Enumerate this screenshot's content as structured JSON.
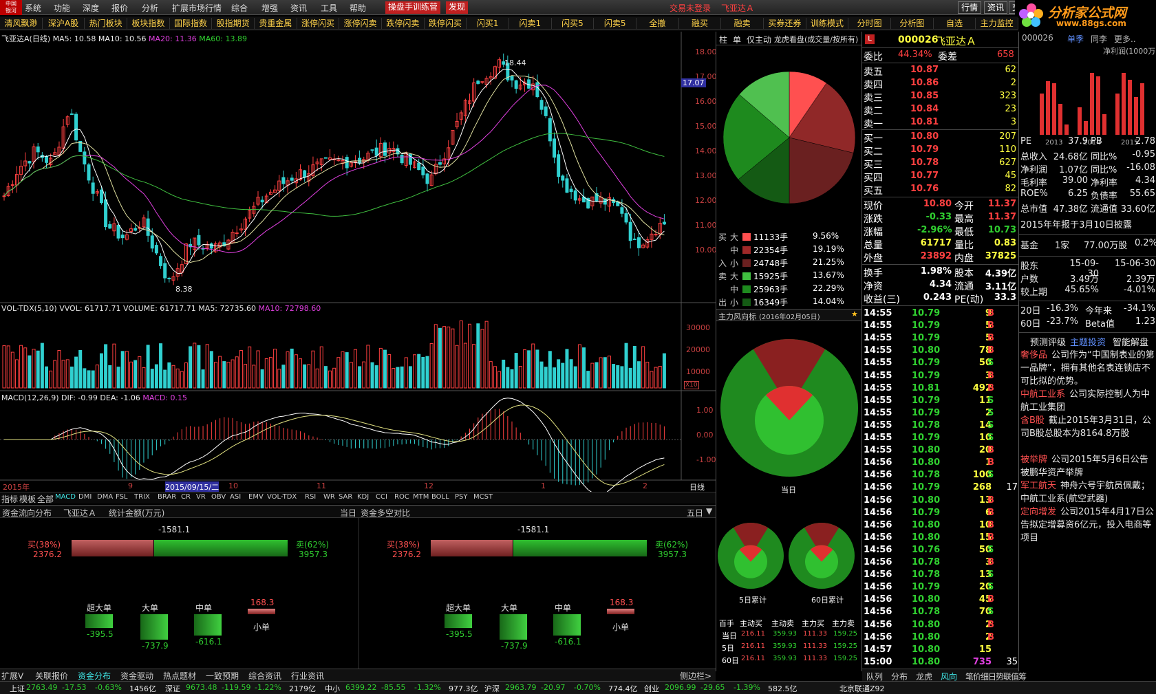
{
  "menu": {
    "items": [
      "系统",
      "功能",
      "深度",
      "报价",
      "分析",
      "扩展市场行情",
      "综合",
      "增强",
      "资讯",
      "工具",
      "帮助"
    ],
    "training": "操盘手训练营",
    "discover": "发现",
    "trade_status": "交易未登录",
    "stock_name_title": "飞亚达Ａ",
    "right_buttons": [
      "行情",
      "资讯",
      "交"
    ]
  },
  "logo": {
    "text": "中国\n银河"
  },
  "watermark": {
    "title": "分析家公式网",
    "url": "www.88gs.com"
  },
  "quickbar": [
    "清风飘渺",
    "深沪A股",
    "热门板块",
    "板块指数",
    "国际指数",
    "股指期货",
    "贵重金属",
    "涨停闪买",
    "涨停闪卖",
    "跌停闪卖",
    "跌停闪买",
    "闪买1",
    "闪卖1",
    "闪买5",
    "闪卖5",
    "全撤",
    "融买",
    "融卖",
    "买券还券",
    "训练模式",
    "分时图",
    "分析图",
    "自选",
    "主力监控"
  ],
  "chart": {
    "title": "飞亚达A(日线)",
    "ma5": "MA5: 10.58",
    "ma10": "MA10: 10.56",
    "ma20": "MA20: 11.36",
    "ma60": "MA60: 13.89",
    "price_axis": [
      "18.00",
      "17.00",
      "16.00",
      "15.00",
      "14.00",
      "13.00",
      "12.00",
      "11.00",
      "10.00"
    ],
    "current_price_tag": "17.07",
    "high_label": "18.44",
    "low_label": "8.38",
    "vol_title": "VOL-TDX(5,10)",
    "vvol": "VVOL: 61717.71",
    "volume": "VOLUME: 61717.71",
    "vma5": "MA5: 72735.60",
    "vma10": "MA10: 72798.60",
    "vol_axis": [
      "30000",
      "20000",
      "10000"
    ],
    "vol_unit": "X10",
    "macd_title": "MACD(12,26,9)",
    "dif": "DIF: -0.99",
    "dea": "DEA: -1.06",
    "macd": "MACD: 0.15",
    "macd_axis": [
      "1.00",
      "0.00",
      "-1.00"
    ],
    "time_axis": [
      "2015年",
      "9",
      "2015/09/15/二",
      "10",
      "11",
      "12",
      "1",
      "2"
    ],
    "period": "日线",
    "indicator_tabs": [
      "指标",
      "模板",
      "全部",
      "MACD",
      "DMI",
      "DMA",
      "FSL",
      "TRIX",
      "BRAR",
      "CR",
      "VR",
      "OBV",
      "ASI",
      "EMV",
      "VOL-TDX",
      "RSI",
      "WR",
      "SAR",
      "KDJ",
      "CCI",
      "ROC",
      "MTM",
      "BOLL",
      "PSY",
      "MCST"
    ]
  },
  "bigorder": {
    "tabs": [
      "柱",
      "单",
      "仅主动",
      "龙虎看盘(成交量/按所有)"
    ],
    "rows": [
      {
        "side": "买",
        "size": "大",
        "vol": "11133手",
        "pct": "9.56%",
        "color": "#ff5050"
      },
      {
        "side": "",
        "size": "中",
        "vol": "22354手",
        "pct": "19.19%",
        "color": "#a02828"
      },
      {
        "side": "入",
        "size": "小",
        "vol": "24748手",
        "pct": "21.25%",
        "color": "#6a2020"
      },
      {
        "side": "卖",
        "size": "大",
        "vol": "15925手",
        "pct": "13.67%",
        "color": "#40c040"
      },
      {
        "side": "",
        "size": "中",
        "vol": "25963手",
        "pct": "22.29%",
        "color": "#1e8a1e"
      },
      {
        "side": "出",
        "size": "小",
        "vol": "16349手",
        "pct": "14.04%",
        "color": "#145a14"
      }
    ],
    "pie_values": [
      9.56,
      19.19,
      21.25,
      14.04,
      22.29,
      13.67
    ],
    "wind_title": "主力风向标",
    "wind_date": "(2016年02月05日)",
    "today": "当日",
    "five": "5日累计",
    "sixty": "60日累计",
    "table_header": [
      "百手",
      "主动买",
      "主动卖",
      "主力买",
      "主力卖"
    ],
    "table_rows": [
      [
        "当日",
        "216.11",
        "359.93",
        "111.33",
        "159.25"
      ],
      [
        "5日",
        "216.11",
        "359.93",
        "111.33",
        "159.25"
      ],
      [
        "60日",
        "216.11",
        "359.93",
        "111.33",
        "159.25"
      ]
    ]
  },
  "quote": {
    "code": "000026",
    "name": "飞亚达Ａ",
    "weibi_label": "委比",
    "weibi": "44.34%",
    "weicha_label": "委差",
    "weicha": "658",
    "sells": [
      [
        "卖五",
        "10.87",
        "62"
      ],
      [
        "卖四",
        "10.86",
        "2"
      ],
      [
        "卖三",
        "10.85",
        "323"
      ],
      [
        "卖二",
        "10.84",
        "23"
      ],
      [
        "卖一",
        "10.81",
        "3"
      ]
    ],
    "buys": [
      [
        "买一",
        "10.80",
        "207"
      ],
      [
        "买二",
        "10.79",
        "110"
      ],
      [
        "买三",
        "10.78",
        "627"
      ],
      [
        "买四",
        "10.77",
        "45"
      ],
      [
        "买五",
        "10.76",
        "82"
      ]
    ],
    "info": [
      [
        "现价",
        "10.80",
        "今开",
        "11.37"
      ],
      [
        "涨跌",
        "-0.33",
        "最高",
        "11.37"
      ],
      [
        "涨幅",
        "-2.96%",
        "最低",
        "10.73"
      ],
      [
        "总量",
        "61717",
        "量比",
        "0.83"
      ],
      [
        "外盘",
        "23892",
        "内盘",
        "37825"
      ]
    ],
    "info2": [
      [
        "换手",
        "1.98%",
        "股本",
        "4.39亿"
      ],
      [
        "净资",
        "4.34",
        "流通",
        "3.11亿"
      ],
      [
        "收益(三)",
        "0.243",
        "PE(动)",
        "33.3"
      ]
    ],
    "ticks": [
      [
        "14:55",
        "10.79",
        "9",
        "B"
      ],
      [
        "14:55",
        "10.79",
        "5",
        "B"
      ],
      [
        "14:55",
        "10.79",
        "5",
        "B"
      ],
      [
        "14:55",
        "10.80",
        "78",
        "B"
      ],
      [
        "14:55",
        "10.79",
        "50",
        "S"
      ],
      [
        "14:55",
        "10.79",
        "3",
        "B"
      ],
      [
        "14:55",
        "10.81",
        "492",
        "B"
      ],
      [
        "14:55",
        "10.79",
        "11",
        "S"
      ],
      [
        "14:55",
        "10.79",
        "2",
        "S"
      ],
      [
        "14:55",
        "10.78",
        "14",
        "S"
      ],
      [
        "14:55",
        "10.79",
        "10",
        "S"
      ],
      [
        "14:55",
        "10.80",
        "20",
        "B"
      ],
      [
        "14:56",
        "10.80",
        "1",
        "B"
      ],
      [
        "14:56",
        "10.78",
        "100",
        "S"
      ],
      [
        "14:56",
        "10.79",
        "268",
        ""
      ],
      [
        "14:56",
        "10.80",
        "13",
        "B"
      ],
      [
        "14:56",
        "10.79",
        "6",
        "B"
      ],
      [
        "14:56",
        "10.80",
        "10",
        "B"
      ],
      [
        "14:56",
        "10.80",
        "15",
        "B"
      ],
      [
        "14:56",
        "10.76",
        "50",
        "S"
      ],
      [
        "14:56",
        "10.78",
        "3",
        "B"
      ],
      [
        "14:56",
        "10.78",
        "13",
        "S"
      ],
      [
        "14:56",
        "10.79",
        "20",
        "S"
      ],
      [
        "14:56",
        "10.80",
        "45",
        "B"
      ],
      [
        "14:56",
        "10.78",
        "70",
        "S"
      ],
      [
        "14:56",
        "10.80",
        "2",
        "B"
      ],
      [
        "14:56",
        "10.80",
        "2",
        "B"
      ],
      [
        "14:57",
        "10.80",
        "15",
        ""
      ],
      [
        "15:00",
        "10.80",
        "735",
        ""
      ]
    ],
    "tick_extra": "17",
    "tick_last_extra": "35",
    "tabs": [
      "队列",
      "分布",
      "龙虎",
      "风向",
      "笔",
      "价",
      "细",
      "日",
      "势",
      "联",
      "值",
      "筹"
    ]
  },
  "f10": {
    "code": "000026",
    "tabs": [
      "单季",
      "同李",
      "更多.."
    ],
    "chart_title": "净利润(1000万)",
    "years": [
      "2013",
      "2014",
      "2015"
    ],
    "bars": [
      6,
      7.8,
      7.5,
      4.5,
      1.5,
      4,
      2,
      9,
      8.5,
      3,
      6,
      9,
      8,
      5.5,
      7.5
    ],
    "fin": [
      [
        "PE",
        "37.9",
        "PB",
        "2.78"
      ],
      [
        "总收入",
        "24.68亿",
        "同比%",
        "-0.95"
      ],
      [
        "净利润",
        "1.07亿",
        "同比%",
        "-16.08"
      ],
      [
        "毛利率",
        "39.00",
        "净利率",
        "4.34"
      ],
      [
        "ROE%",
        "6.25",
        "负债率",
        "55.65"
      ],
      [
        "总市值",
        "47.38亿",
        "流通值",
        "33.60亿"
      ]
    ],
    "report": "2015年年报于3月10日披露",
    "fund": [
      "基金",
      "1家",
      "77.00万股",
      "0.2%"
    ],
    "holders": [
      [
        "股东",
        "15-09-30",
        "15-06-30"
      ],
      [
        "户数",
        "3.49万",
        "2.39万"
      ],
      [
        "较上期",
        "45.65%",
        "-4.01%"
      ]
    ],
    "perf": [
      [
        "20日",
        "-16.3%",
        "今年来",
        "-34.1%"
      ],
      [
        "60日",
        "-23.7%",
        "Beta值",
        "1.23"
      ]
    ],
    "news_links": [
      "预测评级",
      "主题投资",
      "智能解盘"
    ],
    "news": [
      [
        "奢侈品",
        "公司作为“中国制表业的第一品牌”，拥有其他名表连锁店不可比拟的优势。"
      ],
      [
        "中航工业系",
        "公司实际控制人为中航工业集团"
      ],
      [
        "含B股",
        "截止2015年3月31日，公司B股总股本为8164.8万股"
      ],
      [
        "被举牌",
        "公司2015年5月6日公告被鹏华资产举牌"
      ],
      [
        "军工航天",
        "神舟六号宇航员佩戴；中航工业系(航空武器)"
      ],
      [
        "定向增发",
        "公司2015年4月17日公告拟定增募资6亿元，投入电商等项目"
      ]
    ]
  },
  "fund": {
    "title": "资金流向分布",
    "stock": "飞亚达Ａ",
    "unit": "统计金额(万元)",
    "today": "当日",
    "title2": "资金多空对比",
    "period": "五日",
    "net": "-1581.1",
    "buy_pct": "买(38%)",
    "buy_amt": "2376.2",
    "sell_pct": "卖(62%)",
    "sell_amt": "3957.3",
    "buy_ratio": 0.38,
    "cats": [
      [
        "超大单",
        "-395.5"
      ],
      [
        "大单",
        "-737.9"
      ],
      [
        "中单",
        "-616.1"
      ],
      [
        "小单",
        "168.3"
      ]
    ]
  },
  "bottom_tabs": [
    "扩展V",
    "关联报价",
    "资金分布",
    "资金驱动",
    "热点题材",
    "一致预期",
    "综合资讯",
    "行业资讯"
  ],
  "side_label": "侧边栏>",
  "status": [
    [
      "上证",
      "2763.49",
      "-17.53",
      "-0.63%",
      "1456亿"
    ],
    [
      "深证",
      "9673.48",
      "-119.59",
      "-1.22%",
      "2179亿"
    ],
    [
      "中小",
      "6399.22",
      "-85.55",
      "-1.32%",
      "977.3亿"
    ],
    [
      "沪深",
      "2963.79",
      "-20.97",
      "-0.70%",
      "774.4亿"
    ],
    [
      "创业",
      "2096.99",
      "-29.65",
      "-1.39%",
      "582.5亿"
    ]
  ],
  "conn": "北京联通Z92",
  "colors": {
    "up": "#ff4040",
    "down": "#30d0d0",
    "ma5": "#ffffff",
    "ma10": "#ffff40",
    "ma20": "#e040e0",
    "ma60": "#40c040"
  }
}
